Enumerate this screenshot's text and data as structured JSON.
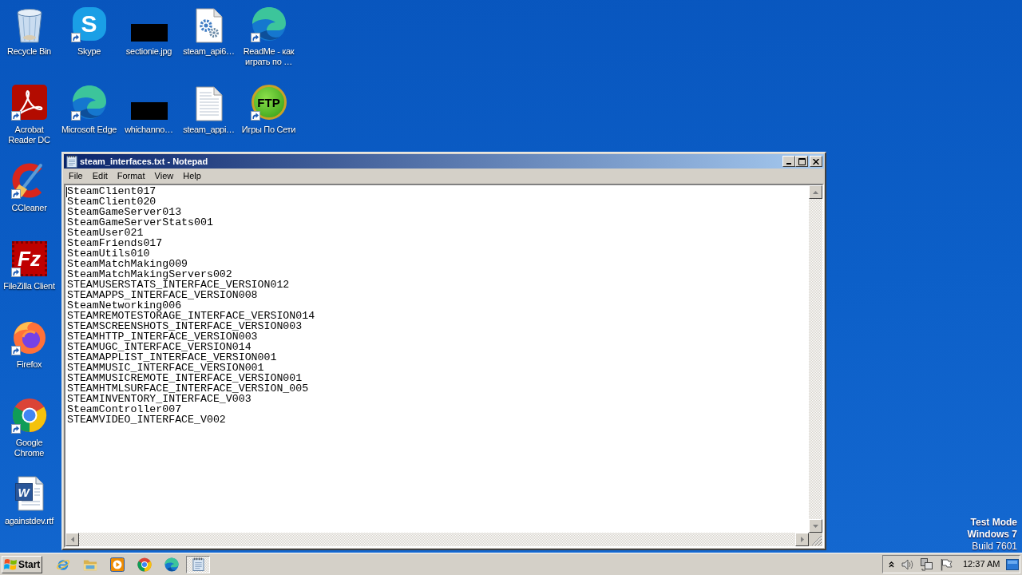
{
  "desktop": {
    "icon_columns": [
      [
        {
          "label": "Recycle Bin",
          "kind": "recycle_bin",
          "shortcut": false
        },
        {
          "label": "Acrobat Reader DC",
          "kind": "acrobat",
          "shortcut": true
        },
        {
          "label": "CCleaner",
          "kind": "ccleaner",
          "shortcut": true
        },
        {
          "label": "FileZilla Client",
          "kind": "filezilla",
          "logo_text": "Fz",
          "shortcut": true
        },
        {
          "label": "Firefox",
          "kind": "firefox",
          "shortcut": true
        },
        {
          "label": "Google Chrome",
          "kind": "chrome",
          "shortcut": true
        },
        {
          "label": "againstdev.rtf",
          "kind": "word_document",
          "logo_text": "W",
          "shortcut": false
        }
      ],
      [
        {
          "label": "Skype",
          "kind": "skype",
          "logo_text": "S",
          "shortcut": true
        },
        {
          "label": "Microsoft Edge",
          "kind": "edge",
          "shortcut": true
        }
      ],
      [
        {
          "label": "sectionie.jpg",
          "kind": "image",
          "shortcut": false
        },
        {
          "label": "whichanno…",
          "kind": "image",
          "shortcut": false
        }
      ],
      [
        {
          "label": "steam_api6…",
          "kind": "settings_file",
          "shortcut": false
        },
        {
          "label": "steam_appi…",
          "kind": "text_file",
          "shortcut": false
        }
      ],
      [
        {
          "label": "ReadMe - как играть по …",
          "kind": "edge",
          "shortcut": true
        },
        {
          "label": "Игры По Сети",
          "kind": "ftp",
          "logo_text": "FTP",
          "shortcut": true
        }
      ]
    ],
    "test_mode_notice": {
      "mode": "Test Mode",
      "edition": "Windows 7",
      "build": "Build 7601"
    }
  },
  "notepad": {
    "title": "steam_interfaces.txt - Notepad",
    "menu": [
      "File",
      "Edit",
      "Format",
      "View",
      "Help"
    ],
    "lines": [
      "SteamClient017",
      "SteamClient020",
      "SteamGameServer013",
      "SteamGameServerStats001",
      "SteamUser021",
      "SteamFriends017",
      "SteamUtils010",
      "SteamMatchMaking009",
      "SteamMatchMakingServers002",
      "STEAMUSERSTATS_INTERFACE_VERSION012",
      "STEAMAPPS_INTERFACE_VERSION008",
      "SteamNetworking006",
      "STEAMREMOTESTORAGE_INTERFACE_VERSION014",
      "STEAMSCREENSHOTS_INTERFACE_VERSION003",
      "STEAMHTTP_INTERFACE_VERSION003",
      "STEAMUGC_INTERFACE_VERSION014",
      "STEAMAPPLIST_INTERFACE_VERSION001",
      "STEAMMUSIC_INTERFACE_VERSION001",
      "STEAMMUSICREMOTE_INTERFACE_VERSION001",
      "STEAMHTMLSURFACE_INTERFACE_VERSION_005",
      "STEAMINVENTORY_INTERFACE_V003",
      "SteamController007",
      "STEAMVIDEO_INTERFACE_V002"
    ]
  },
  "taskbar": {
    "start": "Start",
    "apps": [
      {
        "kind": "ie",
        "selected": false
      },
      {
        "kind": "explorer",
        "selected": false
      },
      {
        "kind": "media_player",
        "selected": false
      },
      {
        "kind": "chrome",
        "selected": false
      },
      {
        "kind": "edge",
        "selected": false
      },
      {
        "kind": "notepad",
        "selected": true
      }
    ],
    "clock": "12:37 AM"
  }
}
